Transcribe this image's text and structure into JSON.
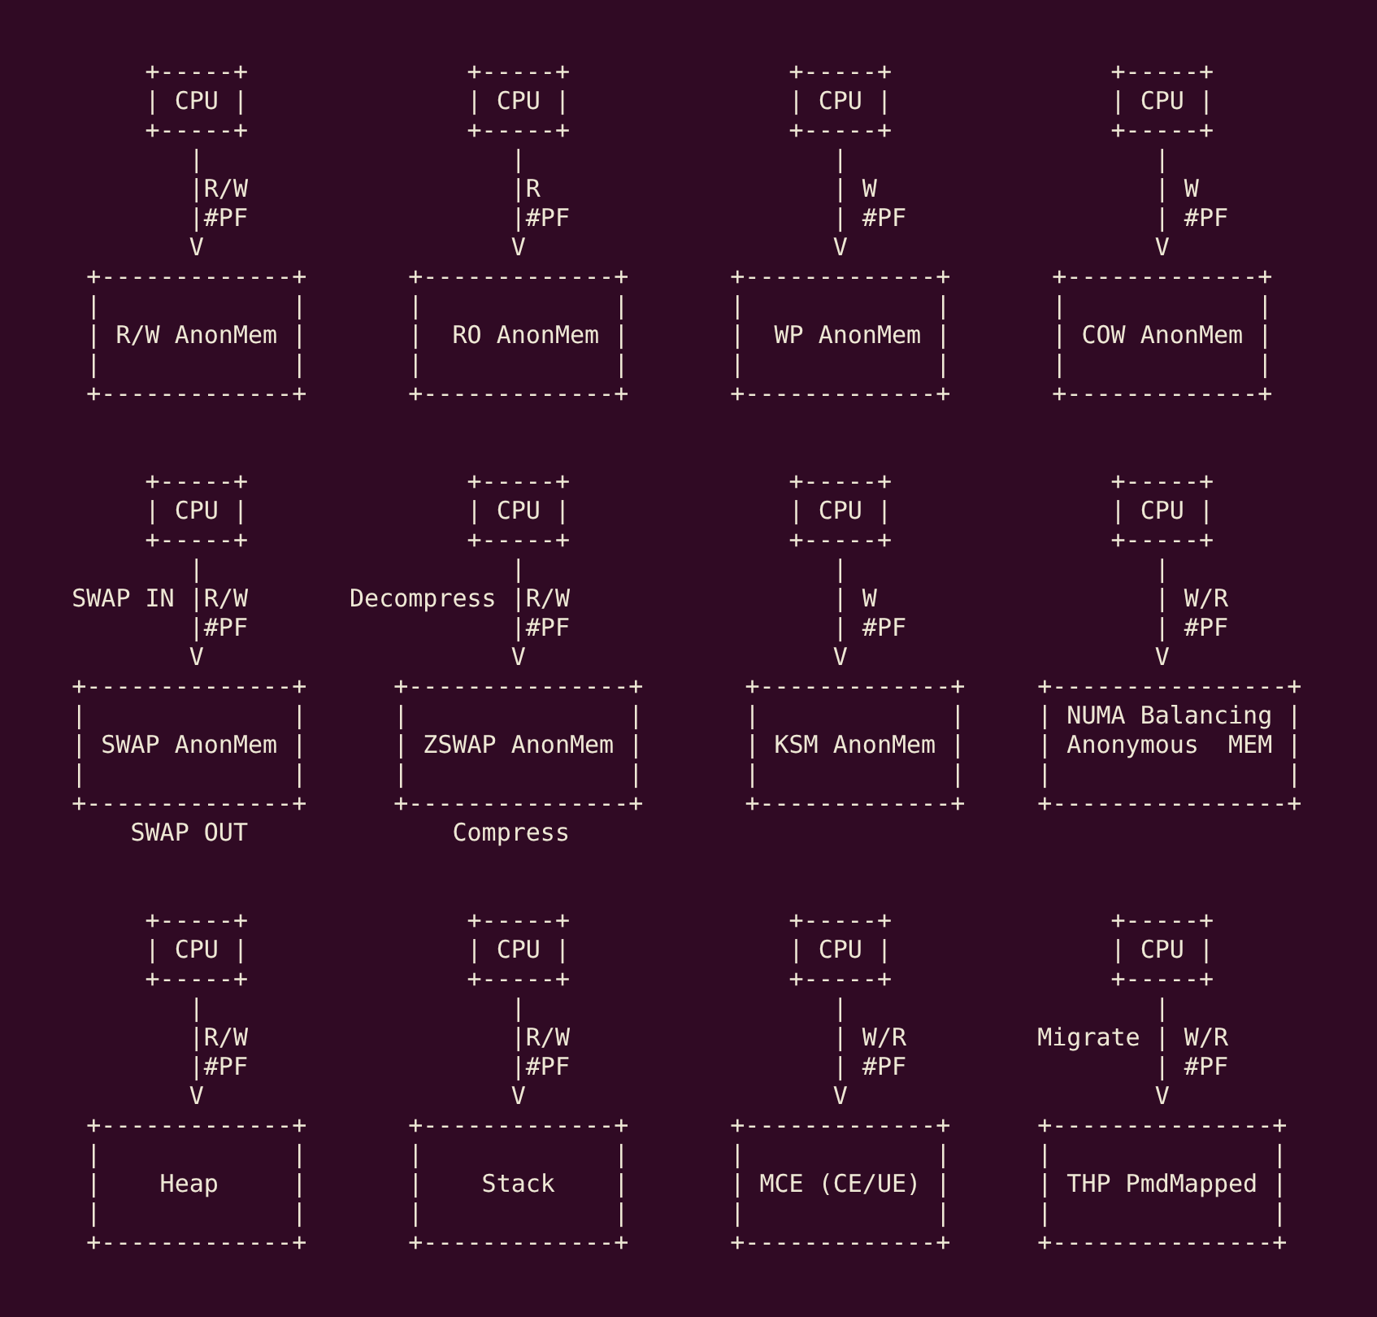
{
  "diagrams": [
    {
      "lines": [
        "         +-----+",
        "         | CPU |",
        "         +-----+",
        "            |",
        "            |R/W",
        "            |#PF",
        "            V",
        "     +-------------+",
        "     |             |",
        "     | R/W AnonMem |",
        "     |             |",
        "     +-------------+"
      ]
    },
    {
      "lines": [
        "         +-----+",
        "         | CPU |",
        "         +-----+",
        "            |",
        "            |R",
        "            |#PF",
        "            V",
        "     +-------------+",
        "     |             |",
        "     |  RO AnonMem |",
        "     |             |",
        "     +-------------+"
      ]
    },
    {
      "lines": [
        "         +-----+",
        "         | CPU |",
        "         +-----+",
        "            |",
        "            | W",
        "            | #PF",
        "            V",
        "     +-------------+",
        "     |             |",
        "     |  WP AnonMem |",
        "     |             |",
        "     +-------------+"
      ]
    },
    {
      "lines": [
        "         +-----+",
        "         | CPU |",
        "         +-----+",
        "            |",
        "            | W",
        "            | #PF",
        "            V",
        "     +-------------+",
        "     |             |",
        "     | COW AnonMem |",
        "     |             |",
        "     +-------------+"
      ]
    },
    {
      "lines": [
        "         +-----+",
        "         | CPU |",
        "         +-----+",
        "            |",
        "    SWAP IN |R/W",
        "            |#PF",
        "            V",
        "    +--------------+",
        "    |              |",
        "    | SWAP AnonMem |",
        "    |              |",
        "    +--------------+",
        "        SWAP OUT"
      ]
    },
    {
      "lines": [
        "         +-----+",
        "         | CPU |",
        "         +-----+",
        "            |",
        " Decompress |R/W",
        "            |#PF",
        "            V",
        "    +---------------+",
        "    |               |",
        "    | ZSWAP AnonMem |",
        "    |               |",
        "    +---------------+",
        "        Compress"
      ]
    },
    {
      "lines": [
        "         +-----+",
        "         | CPU |",
        "         +-----+",
        "            |",
        "            | W",
        "            | #PF",
        "            V",
        "      +-------------+",
        "      |             |",
        "      | KSM AnonMem |",
        "      |             |",
        "      +-------------+"
      ]
    },
    {
      "lines": [
        "         +-----+",
        "         | CPU |",
        "         +-----+",
        "            |",
        "            | W/R",
        "            | #PF",
        "            V",
        "    +----------------+",
        "    | NUMA Balancing |",
        "    | Anonymous  MEM |",
        "    |                |",
        "    +----------------+"
      ]
    },
    {
      "lines": [
        "         +-----+",
        "         | CPU |",
        "         +-----+",
        "            |",
        "            |R/W",
        "            |#PF",
        "            V",
        "     +-------------+",
        "     |             |",
        "     |    Heap     |",
        "     |             |",
        "     +-------------+"
      ]
    },
    {
      "lines": [
        "         +-----+",
        "         | CPU |",
        "         +-----+",
        "            |",
        "            |R/W",
        "            |#PF",
        "            V",
        "     +-------------+",
        "     |             |",
        "     |    Stack    |",
        "     |             |",
        "     +-------------+"
      ]
    },
    {
      "lines": [
        "         +-----+",
        "         | CPU |",
        "         +-----+",
        "            |",
        "            | W/R",
        "            | #PF",
        "            V",
        "     +-------------+",
        "     |             |",
        "     | MCE (CE/UE) |",
        "     |             |",
        "     +-------------+"
      ]
    },
    {
      "lines": [
        "         +-----+",
        "         | CPU |",
        "         +-----+",
        "            |",
        "    Migrate | W/R",
        "            | #PF",
        "            V",
        "    +---------------+",
        "    |               |",
        "    | THP PmdMapped |",
        "    |               |",
        "    +---------------+"
      ]
    }
  ]
}
